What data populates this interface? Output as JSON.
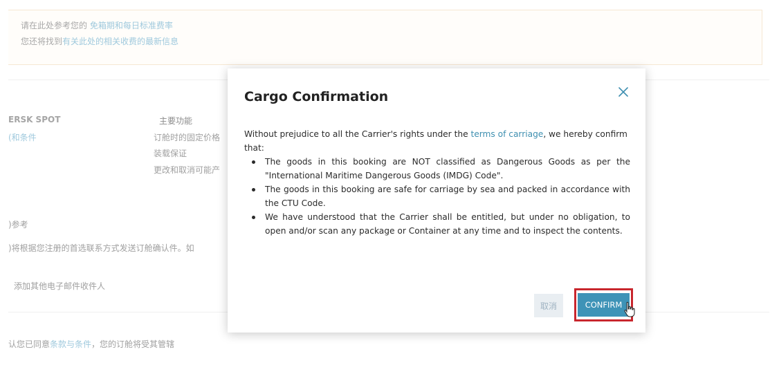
{
  "background": {
    "notice": {
      "line1_prefix": "请在此处参考您的",
      "line1_link": "免箱期和每日标准费率",
      "line2_prefix": "您还将找到",
      "line2_link": "有关此处的相关收费的最新信息"
    },
    "product_name": "ERSK SPOT",
    "terms_link": "(和条件",
    "features_title": "主要功能",
    "features": [
      "订舱时的固定价格",
      "装载保证",
      "更改和取消可能产"
    ],
    "reference_heading": ")参考",
    "reference_text": ")将根据您注册的首选联系方式发送订舱确认件。如",
    "add_email": "添加其他电子邮件收件人",
    "agree_prefix": "认您已同意",
    "agree_link": "条款与条件",
    "agree_suffix": "，您的订舱将受其管辖"
  },
  "modal": {
    "title": "Cargo Confirmation",
    "intro_before": "Without prejudice to all the Carrier's rights under the ",
    "intro_link": "terms of carriage",
    "intro_after": ", we hereby confirm that:",
    "bullets": [
      "The goods in this booking are NOT classified as Dangerous Goods as per the \"International Maritime Dangerous Goods (IMDG) Code\".",
      "The goods in this booking are safe for carriage by sea and packed in accordance with the CTU Code.",
      "We have understood that the Carrier shall be entitled, but under no obligation, to open and/or scan any package or Container at any time and to inspect the contents."
    ],
    "cancel_label": "取消",
    "confirm_label": "CONFIRM",
    "close_icon": "close-icon"
  },
  "colors": {
    "accent": "#3e93b7",
    "link": "#3e8fb0",
    "highlight": "#c8262d"
  }
}
